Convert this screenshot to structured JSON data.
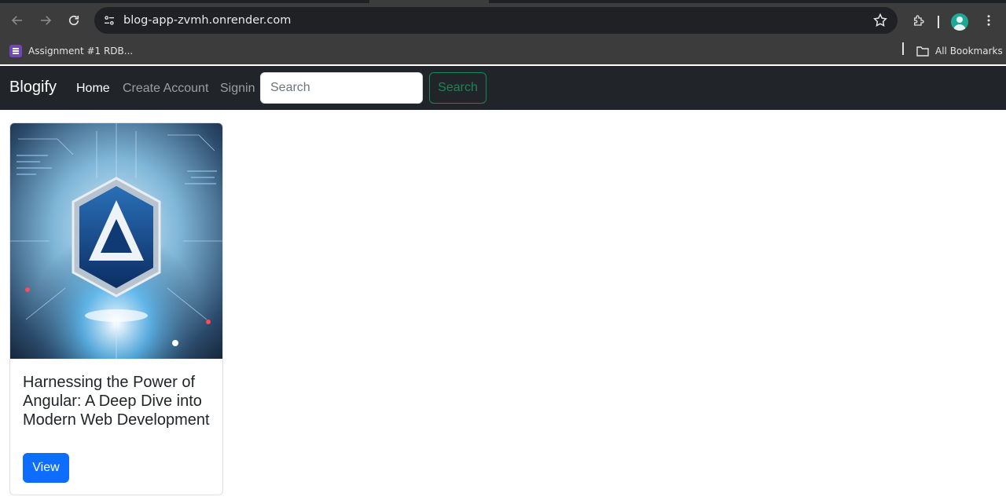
{
  "browser": {
    "url": "blog-app-zvmh.onrender.com",
    "bookmarks": [
      {
        "label": "Assignment #1 RDB...",
        "icon": "google-forms-icon"
      }
    ],
    "all_bookmarks_label": "All Bookmarks"
  },
  "navbar": {
    "brand": "Blogify",
    "links": [
      {
        "label": "Home",
        "active": true
      },
      {
        "label": "Create Account",
        "active": false
      },
      {
        "label": "Signin",
        "active": false
      }
    ],
    "search_placeholder": "Search",
    "search_button": "Search"
  },
  "posts": [
    {
      "title": "Harnessing the Power of Angular: A Deep Dive into Modern Web Development",
      "view_label": "View",
      "image": "angular-logo-illustration"
    }
  ],
  "colors": {
    "navbar_bg": "#212529",
    "primary": "#0d6efd",
    "success": "#198754"
  }
}
